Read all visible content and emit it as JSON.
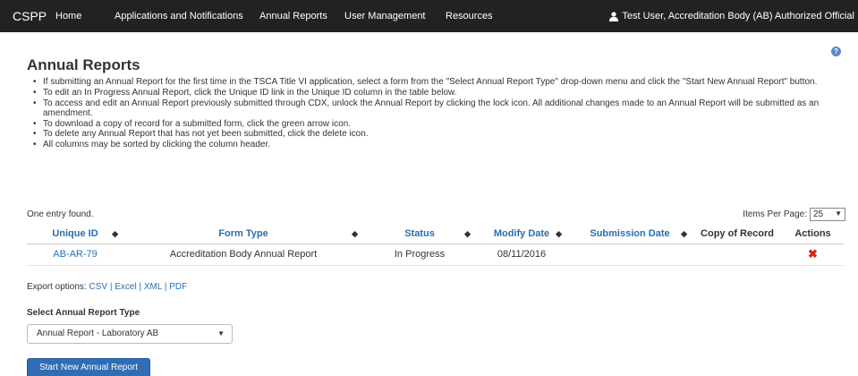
{
  "navbar": {
    "brand": "CSPP",
    "items": [
      "Home",
      "Applications and Notifications",
      "Annual Reports",
      "User Management",
      "Resources"
    ],
    "user": "Test User, Accreditation Body (AB) Authorized Official"
  },
  "help_icon": "?",
  "page": {
    "title": "Annual Reports",
    "instructions": [
      "If submitting an Annual Report for the first time in the TSCA Title VI application, select a form from the \"Select Annual Report Type\" drop-down menu and click the \"Start New Annual Report\" button.",
      "To edit an In Progress Annual Report, click the Unique ID link in the Unique ID column in the table below.",
      "To access and edit an Annual Report previously submitted through CDX, unlock the Annual Report by clicking the lock icon. All additional changes made to an Annual Report will be submitted as an amendment.",
      "To download a copy of record for a submitted form, click the green arrow icon.",
      "To delete any Annual Report that has not yet been submitted, click the delete icon.",
      "All columns may be sorted by clicking the column header."
    ]
  },
  "table_meta": {
    "entry_count": "One entry found.",
    "items_per_page_label": "Items Per Page:",
    "items_per_page_value": "25"
  },
  "table": {
    "headers": [
      "Unique ID",
      "Form Type",
      "Status",
      "Modify Date",
      "Submission Date",
      "Copy of Record",
      "Actions"
    ],
    "sort_icon": "◆",
    "rows": [
      {
        "unique_id": "AB-AR-79",
        "form_type": "Accreditation Body Annual Report",
        "status": "In Progress",
        "modify_date": "08/11/2016",
        "submission_date": "",
        "copy_of_record": "",
        "action_icon": "✖"
      }
    ]
  },
  "export": {
    "label": "Export options:",
    "options": [
      "CSV",
      "Excel",
      "XML",
      "PDF"
    ]
  },
  "select_type": {
    "label": "Select Annual Report Type",
    "value": "Annual Report - Laboratory AB"
  },
  "start_button": "Start New Annual Report",
  "colors": {
    "navbar_bg": "#222222",
    "link": "#2a6fb0",
    "button": "#2f6db5",
    "delete": "#d9231b"
  }
}
